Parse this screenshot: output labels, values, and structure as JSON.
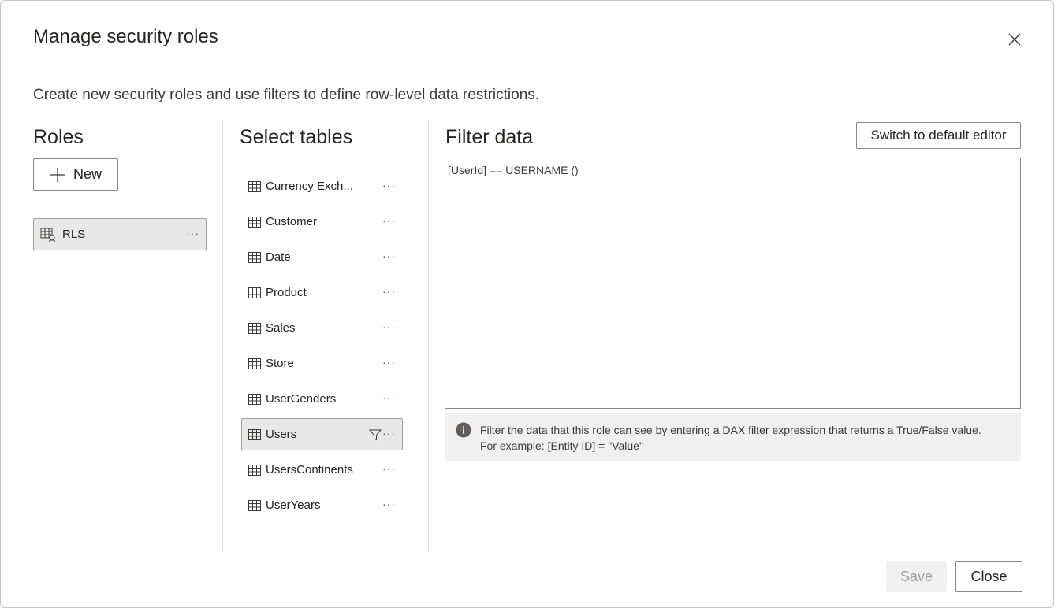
{
  "dialog": {
    "title": "Manage security roles",
    "subtitle": "Create new security roles and use filters to define row-level data restrictions."
  },
  "roles": {
    "heading": "Roles",
    "new_button_label": "New",
    "items": [
      {
        "label": "RLS",
        "selected": true
      }
    ]
  },
  "tables": {
    "heading": "Select tables",
    "items": [
      {
        "label": "Currency Exch...",
        "selected": false,
        "has_filter": false
      },
      {
        "label": "Customer",
        "selected": false,
        "has_filter": false
      },
      {
        "label": "Date",
        "selected": false,
        "has_filter": false
      },
      {
        "label": "Product",
        "selected": false,
        "has_filter": false
      },
      {
        "label": "Sales",
        "selected": false,
        "has_filter": false
      },
      {
        "label": "Store",
        "selected": false,
        "has_filter": false
      },
      {
        "label": "UserGenders",
        "selected": false,
        "has_filter": false
      },
      {
        "label": "Users",
        "selected": true,
        "has_filter": true
      },
      {
        "label": "UsersContinents",
        "selected": false,
        "has_filter": false
      },
      {
        "label": "UserYears",
        "selected": false,
        "has_filter": false
      }
    ]
  },
  "filter": {
    "heading": "Filter data",
    "switch_button_label": "Switch to default editor",
    "expression": "[UserId] == USERNAME ()",
    "info_line1": "Filter the data that this role can see by entering a DAX filter expression that returns a True/False value.",
    "info_line2": "For example: [Entity ID] = \"Value\""
  },
  "footer": {
    "save_label": "Save",
    "close_label": "Close",
    "save_enabled": false
  },
  "more_glyph": "···",
  "icons": {
    "close": "close-icon",
    "add": "plus-icon",
    "role": "role-icon",
    "table": "table-icon",
    "filter": "filter-icon",
    "more": "more-icon",
    "info": "info-icon"
  },
  "colors": {
    "selected_bg": "#e8e8e8",
    "border": "#8a8886",
    "info_bg": "#f0f0f0",
    "disabled_text": "#a19f9d"
  }
}
